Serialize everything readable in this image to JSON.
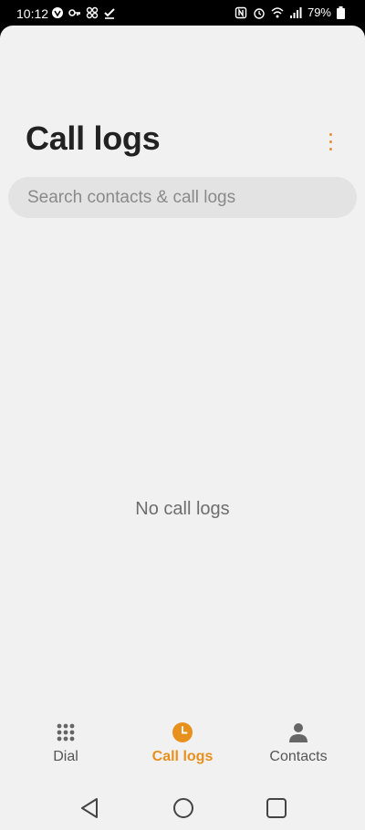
{
  "status_bar": {
    "time": "10:12",
    "battery": "79%"
  },
  "header": {
    "title": "Call logs"
  },
  "search": {
    "placeholder": "Search contacts & call logs"
  },
  "main": {
    "empty_message": "No call logs"
  },
  "bottom_nav": {
    "items": [
      {
        "label": "Dial",
        "icon": "dialpad-icon",
        "active": false
      },
      {
        "label": "Call logs",
        "icon": "clock-icon",
        "active": true
      },
      {
        "label": "Contacts",
        "icon": "person-icon",
        "active": false
      }
    ]
  },
  "colors": {
    "accent": "#e8901c",
    "background": "#f1f1f1",
    "search_bg": "#e3e3e3"
  }
}
